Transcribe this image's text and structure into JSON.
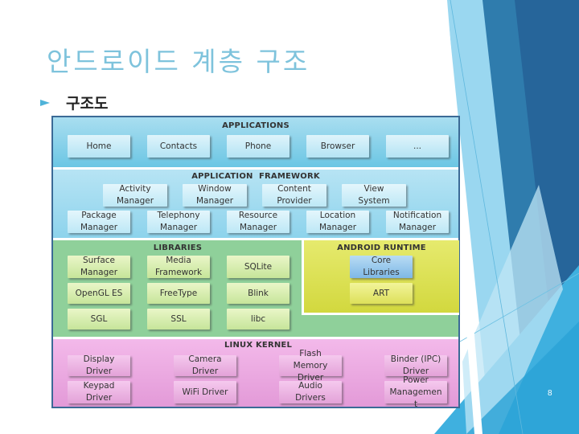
{
  "slide": {
    "title": "안드로이드 계층 구조",
    "bullet": "구조도",
    "page_number": "8"
  },
  "diagram": {
    "applications": {
      "title": "APPLICATIONS",
      "items": [
        "Home",
        "Contacts",
        "Phone",
        "Browser",
        "..."
      ]
    },
    "framework": {
      "title": "APPLICATION  FRAMEWORK",
      "row1": [
        "Activity\nManager",
        "Window\nManager",
        "Content\nProvider",
        "View\nSystem"
      ],
      "row2": [
        "Package\nManager",
        "Telephony\nManager",
        "Resource\nManager",
        "Location\nManager",
        "Notification\nManager"
      ]
    },
    "libraries": {
      "title": "LIBRARIES",
      "items": [
        "Surface\nManager",
        "Media\nFramework",
        "SQLite",
        "OpenGL ES",
        "FreeType",
        "Blink",
        "SGL",
        "SSL",
        "libc"
      ]
    },
    "runtime": {
      "title": "ANDROID RUNTIME",
      "items": [
        "Core\nLibraries",
        "ART"
      ]
    },
    "kernel": {
      "title": "LINUX KERNEL",
      "items": [
        "Display\nDriver",
        "Camera\nDriver",
        "Flash\nMemory\nDriver",
        "Binder (IPC)\nDriver",
        "Keypad\nDriver",
        "WiFi Driver",
        "Audio\nDrivers",
        "Power\nManagemen\nt"
      ]
    }
  },
  "colors": {
    "title": "#7ec3dc",
    "accent": "#4fb3d9",
    "applications": "#6cc6e4",
    "libraries": "#8fd09a",
    "runtime": "#d2d83e",
    "kernel": "#e39ad8"
  }
}
